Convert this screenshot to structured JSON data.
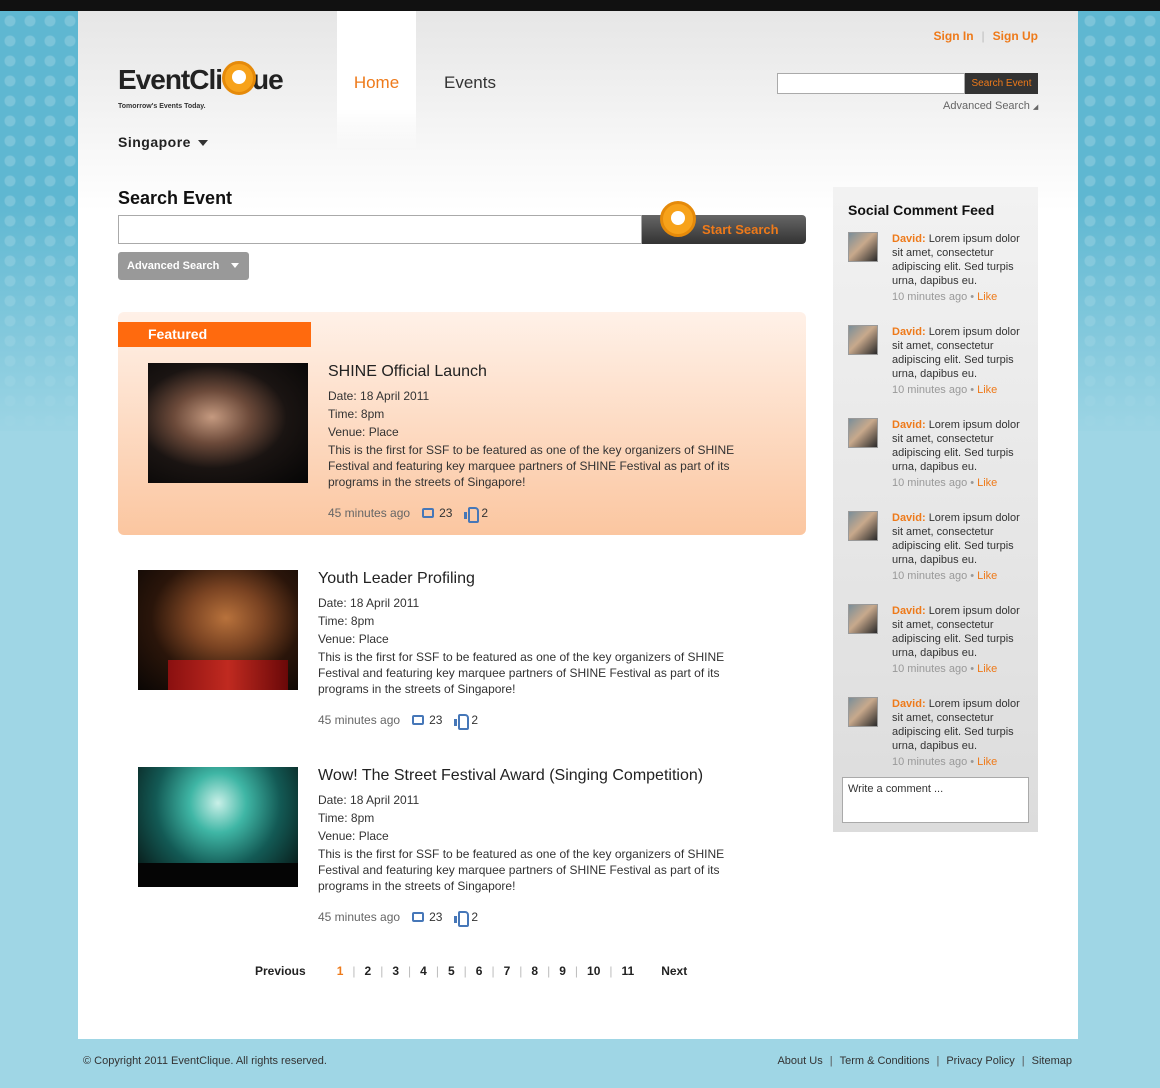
{
  "brand": {
    "name_part1": "EventCli",
    "name_part2": "ue",
    "tagline": "Tomorrow's Events Today."
  },
  "nav": {
    "home": "Home",
    "events": "Events"
  },
  "auth": {
    "sign_in": "Sign In",
    "separator": "|",
    "sign_up": "Sign Up"
  },
  "top_search": {
    "placeholder": "",
    "button": "Search Event",
    "advanced": "Advanced Search"
  },
  "location": {
    "city": "Singapore"
  },
  "main_search": {
    "title": "Search Event",
    "placeholder": "",
    "button": "Start Search",
    "advanced_button": "Advanced Search"
  },
  "featured_label": "Featured",
  "events": [
    {
      "title": "SHINE Official Launch",
      "date": "Date: 18 April 2011",
      "time": "Time: 8pm",
      "venue": "Venue: Place",
      "description": "This is the first for SSF to be featured as one of the key organizers of SHINE Festival and featuring key marquee partners of SHINE Festival as part of its programs in the streets of Singapore!",
      "posted": "45 minutes ago",
      "comments": "23",
      "likes": "2"
    },
    {
      "title": "Youth Leader Profiling",
      "date": "Date: 18 April 2011",
      "time": "Time: 8pm",
      "venue": "Venue: Place",
      "description": "This is the first for SSF to be featured as one of the key organizers of SHINE Festival and featuring key marquee partners of SHINE Festival as part of its programs in the streets of Singapore!",
      "posted": "45 minutes ago",
      "comments": "23",
      "likes": "2"
    },
    {
      "title": "Wow! The Street Festival Award (Singing Competition)",
      "date": "Date: 18 April 2011",
      "time": "Time: 8pm",
      "venue": "Venue: Place",
      "description": "This is the first for SSF to be featured as one of the key organizers of SHINE Festival and featuring key marquee partners of SHINE Festival as part of its programs in the streets of Singapore!",
      "posted": "45 minutes ago",
      "comments": "23",
      "likes": "2"
    }
  ],
  "pagination": {
    "previous": "Previous",
    "pages": [
      "1",
      "2",
      "3",
      "4",
      "5",
      "6",
      "7",
      "8",
      "9",
      "10",
      "11"
    ],
    "current": "1",
    "next": "Next"
  },
  "sidebar": {
    "title": "Social Comment Feed",
    "comments": [
      {
        "author": "David:",
        "text": "Lorem ipsum dolor sit amet, consectetur adipiscing elit. Sed turpis urna, dapibus eu.",
        "time": "10 minutes ago",
        "like": "Like"
      },
      {
        "author": "David:",
        "text": "Lorem ipsum dolor sit amet, consectetur adipiscing elit. Sed turpis urna, dapibus eu.",
        "time": "10 minutes ago",
        "like": "Like"
      },
      {
        "author": "David:",
        "text": "Lorem ipsum dolor sit amet, consectetur adipiscing elit. Sed turpis urna, dapibus eu.",
        "time": "10 minutes ago",
        "like": "Like"
      },
      {
        "author": "David:",
        "text": "Lorem ipsum dolor sit amet, consectetur adipiscing elit. Sed turpis urna, dapibus eu.",
        "time": "10 minutes ago",
        "like": "Like"
      },
      {
        "author": "David:",
        "text": "Lorem ipsum dolor sit amet, consectetur adipiscing elit. Sed turpis urna, dapibus eu.",
        "time": "10 minutes ago",
        "like": "Like"
      },
      {
        "author": "David:",
        "text": "Lorem ipsum dolor sit amet, consectetur adipiscing elit. Sed turpis urna, dapibus eu.",
        "time": "10 minutes ago",
        "like": "Like"
      }
    ],
    "comment_placeholder": "Write a comment ..."
  },
  "footer": {
    "copyright": "© Copyright 2011 EventClique. All rights reserved.",
    "links": [
      "About Us",
      "Term & Conditions",
      "Privacy Policy",
      "Sitemap"
    ]
  },
  "colors": {
    "accent": "#ee7a1a",
    "featured": "#ff6a0e",
    "background": "#9fd6e5",
    "dark_button": "#333333"
  },
  "icons": [
    "q-logo-icon",
    "caret-down-icon",
    "comment-icon",
    "thumbs-up-icon",
    "avatar-image"
  ]
}
